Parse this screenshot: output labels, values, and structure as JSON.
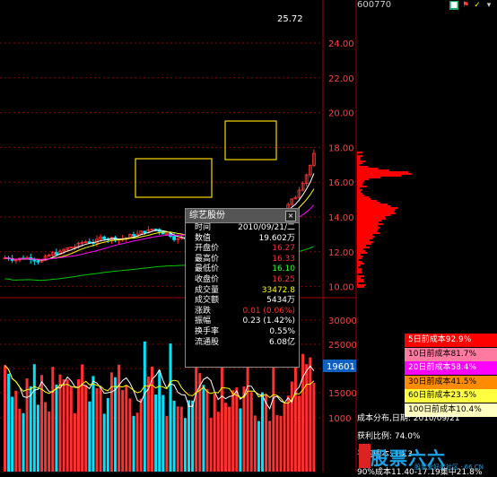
{
  "ticker": "600770",
  "peak_label": "25.72",
  "price_axis": [
    "24.00",
    "22.00",
    "20.00",
    "18.00",
    "16.00",
    "14.00",
    "12.00",
    "10.00"
  ],
  "volume_axis": [
    "30000",
    "25000",
    "20000",
    "15000",
    "1000"
  ],
  "volume_marker": "19601",
  "info_panel": {
    "title": "综艺股份",
    "close_symbol": "×",
    "rows": [
      {
        "label": "时间",
        "value": "2010/09/21/二",
        "color": "#ffffff"
      },
      {
        "label": "数值",
        "value": "19.602万",
        "color": "#ffffff"
      },
      {
        "label": "开盘价",
        "value": "16.27",
        "color": "#ff3030"
      },
      {
        "label": "最高价",
        "value": "16.33",
        "color": "#ff3030"
      },
      {
        "label": "最低价",
        "value": "16.10",
        "color": "#30ff30"
      },
      {
        "label": "收盘价",
        "value": "16.25",
        "color": "#ff3030"
      },
      {
        "label": "成交量",
        "value": "33472.8",
        "color": "#ffff00"
      },
      {
        "label": "成交额",
        "value": "5434万",
        "color": "#ffffff"
      },
      {
        "label": "涨跌",
        "value": "0.01 (0.06%)",
        "color": "#ff3030"
      },
      {
        "label": "振幅",
        "value": "0.23 (1.42%)",
        "color": "#ffffff"
      },
      {
        "label": "换手率",
        "value": "0.55%",
        "color": "#ffffff"
      },
      {
        "label": "流通股",
        "value": "6.08亿",
        "color": "#ffffff"
      }
    ]
  },
  "cost_legend": [
    {
      "label": "5日前成本92.9%",
      "bg": "#ff0000",
      "fg": "#ffffff"
    },
    {
      "label": "10日前成本81.7%",
      "bg": "#ff7aa0",
      "fg": "#000000"
    },
    {
      "label": "20日前成本58.4%",
      "bg": "#ff00ff",
      "fg": "#ffffff"
    },
    {
      "label": "30日前成本41.5%",
      "bg": "#ff8c00",
      "fg": "#000000"
    },
    {
      "label": "60日前成本23.5%",
      "bg": "#ffff40",
      "fg": "#000000"
    },
    {
      "label": "100日前成本10.4%",
      "bg": "#ffffc0",
      "fg": "#000000"
    }
  ],
  "cost_info": [
    "成本分布,日期: 2010/09/21",
    "获利比例: 74.0%",
    "平均成本: 14.3",
    "90%成本11.40-17.19集中21.8%"
  ],
  "watermark": {
    "text": "股票六六",
    "sub": "股票爱好者社区 · 66.CN"
  },
  "colors": {
    "up": "#ff3030",
    "down": "#00e5ff",
    "ma5": "#ffffff",
    "ma10": "#ffff00",
    "ma20": "#ff00ff",
    "ma60": "#00c800",
    "box": "#ffd700",
    "grid": "#8b0000"
  }
}
